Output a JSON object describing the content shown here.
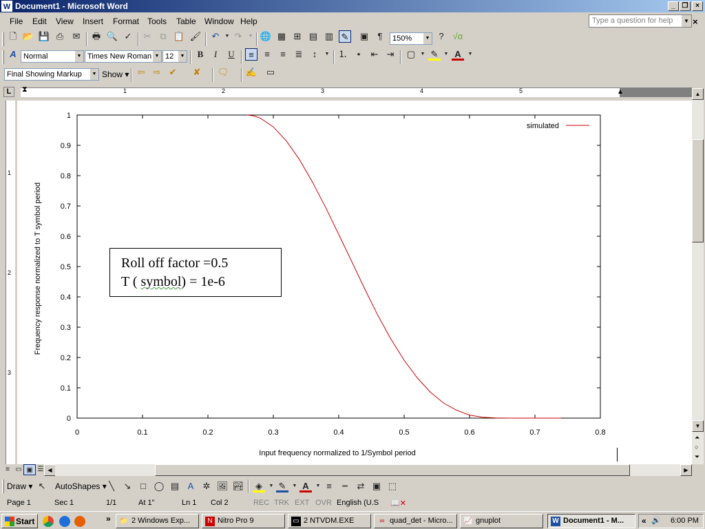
{
  "window": {
    "title": "Document1 - Microsoft Word",
    "app_icon": "W"
  },
  "menu": [
    "File",
    "Edit",
    "View",
    "Insert",
    "Format",
    "Tools",
    "Table",
    "Window",
    "Help"
  ],
  "help_box": {
    "placeholder": "Type a question for help"
  },
  "formatting": {
    "style": "Normal",
    "font": "Times New Roman",
    "size": "12",
    "zoom": "150%"
  },
  "reviewing": {
    "markup": "Final Showing Markup",
    "show_label": "Show"
  },
  "ruler": {
    "numbers": [
      "1",
      "2",
      "3",
      "4",
      "5"
    ],
    "vertical_numbers": [
      "1",
      "2",
      "3"
    ]
  },
  "drawing": {
    "draw_label": "Draw",
    "autoshapes_label": "AutoShapes"
  },
  "status": {
    "page": "Page 1",
    "sec": "Sec 1",
    "pages": "1/1",
    "at": "At 1\"",
    "ln": "Ln 1",
    "col": "Col 2",
    "rec": "REC",
    "trk": "TRK",
    "ext": "EXT",
    "ovr": "OVR",
    "lang": "English (U.S"
  },
  "taskbar": {
    "start": "Start",
    "tasks": [
      "2 Windows Exp...",
      "Nitro Pro 9",
      "2 NTVDM.EXE",
      "quad_det - Micro...",
      "gnuplot",
      "Document1 - M..."
    ],
    "clock": "6:00 PM",
    "chevron": "»",
    "tray_chevron": "«"
  },
  "textbox": {
    "line1": "Roll off factor =0.5",
    "line2_prefix": "T ( ",
    "line2_word": "symbol",
    "line2_suffix": ") = 1e-6"
  },
  "chart_data": {
    "type": "line",
    "xlabel": "Input frequency normalized to 1/Symbol period",
    "ylabel": "Frequency response normalized to T symbol period",
    "xlim": [
      0,
      0.8
    ],
    "ylim": [
      0,
      1
    ],
    "xticks": [
      "0",
      "0.1",
      "0.2",
      "0.3",
      "0.4",
      "0.5",
      "0.6",
      "0.7",
      "0.8"
    ],
    "yticks": [
      "0",
      "0.1",
      "0.2",
      "0.3",
      "0.4",
      "0.5",
      "0.6",
      "0.7",
      "0.8",
      "0.9",
      "1"
    ],
    "legend_position": "top-right",
    "grid": false,
    "series": [
      {
        "name": "simulated",
        "color": "#cc0000",
        "x": [
          0.26,
          0.27,
          0.28,
          0.3,
          0.32,
          0.34,
          0.36,
          0.38,
          0.4,
          0.42,
          0.44,
          0.46,
          0.48,
          0.5,
          0.52,
          0.54,
          0.56,
          0.58,
          0.6,
          0.62,
          0.64,
          0.66,
          0.68,
          0.7,
          0.72,
          0.73,
          0.74
        ],
        "y": [
          1.0,
          0.997,
          0.99,
          0.961,
          0.914,
          0.853,
          0.778,
          0.695,
          0.606,
          0.516,
          0.425,
          0.338,
          0.26,
          0.191,
          0.133,
          0.086,
          0.05,
          0.026,
          0.01,
          0.003,
          0.0005,
          0.0,
          0.0,
          0.0,
          0.0,
          0.0,
          0.0
        ]
      }
    ]
  }
}
